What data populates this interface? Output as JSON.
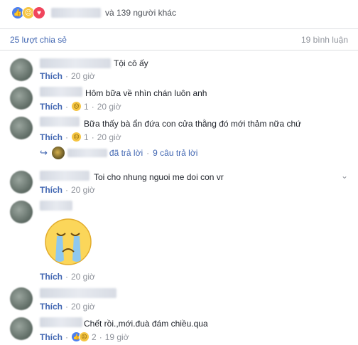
{
  "reactions": {
    "others_text": "và 139 người khác",
    "icons": [
      "like-icon",
      "sad-icon",
      "love-icon"
    ]
  },
  "stats": {
    "shares": "25 lượt chia sẻ",
    "comments": "19 bình luận"
  },
  "comments": [
    {
      "text": "Tội cô ấy",
      "like": "Thích",
      "time": "20 giờ"
    },
    {
      "text": "Hôm bữa về nhìn chán luôn anh",
      "like": "Thích",
      "time": "20 giờ",
      "reaction_count": "1"
    },
    {
      "text": "Bữa thấy bà ẩn đứa con cửa thằng đó mới thảm nữa chứ",
      "like": "Thích",
      "time": "20 giờ",
      "reaction_count": "1"
    },
    {
      "text": "Toi cho nhung nguoi me doi con vr",
      "like": "Thích",
      "time": "20 giờ"
    },
    {
      "text": "",
      "like": "Thích",
      "time": "20 giờ"
    },
    {
      "text": "",
      "like": "Thích",
      "time": "20 giờ"
    },
    {
      "text": "Chết rồi.,mới.đuà đám chiều.qua",
      "like": "Thích",
      "time": "19 giờ",
      "reaction_count": "2"
    }
  ],
  "reply": {
    "replied_text": "đã trả lời",
    "replies_text": "9 câu trả lời"
  },
  "dot": "·"
}
